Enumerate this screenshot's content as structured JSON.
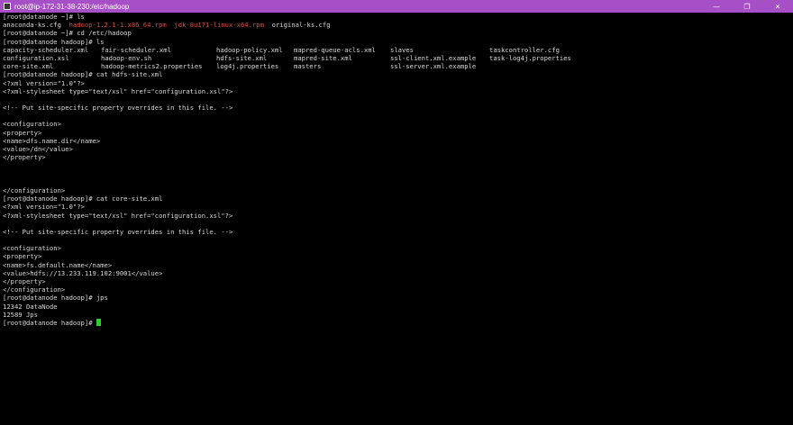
{
  "window": {
    "title": "root@ip-172-31-38-230:/etc/hadoop",
    "minimize_icon": "minimize-icon",
    "maximize_icon": "maximize-icon",
    "close_icon": "close-icon",
    "titlebar_color": "#a64fc6"
  },
  "terminal": {
    "line_00": "[root@datanode ~]# ls",
    "ls_files": [
      "anaconda-ks.cfg",
      "hadoop-1.2.1-1.x86_64.rpm",
      "jdk-8u171-linux-x64.rpm",
      "original-ks.cfg"
    ],
    "line_02": "[root@datanode ~]# cd /etc/hadoop",
    "line_03": "[root@datanode hadoop]# ls",
    "dir_row_1": [
      "capacity-scheduler.xml",
      "fair-scheduler.xml",
      "hadoop-policy.xml",
      "mapred-queue-acls.xml",
      "slaves",
      "taskcontroller.cfg"
    ],
    "dir_row_2": [
      "configuration.xsl",
      "hadoop-env.sh",
      "hdfs-site.xml",
      "mapred-site.xml",
      "ssl-client.xml.example",
      "task-log4j.properties"
    ],
    "dir_row_3": [
      "core-site.xml",
      "hadoop-metrics2.properties",
      "log4j.properties",
      "masters",
      "ssl-server.xml.example"
    ],
    "line_07": "[root@datanode hadoop]# cat hdfs-site.xml",
    "line_08": "<?xml version=\"1.0\"?>",
    "line_09": "<?xml-stylesheet type=\"text/xsl\" href=\"configuration.xsl\"?>",
    "line_10": "",
    "line_11": "<!-- Put site-specific property overrides in this file. -->",
    "line_12": "",
    "line_13": "<configuration>",
    "line_14": "<property>",
    "line_15": "<name>dfs.name.dir</name>",
    "line_16": "<value>/dn</value>",
    "line_17": "</property>",
    "line_18": "",
    "line_19": "",
    "line_20": "",
    "line_21": "</configuration>",
    "line_22": "[root@datanode hadoop]# cat core-site.xml",
    "line_23": "<?xml version=\"1.0\"?>",
    "line_24": "<?xml-stylesheet type=\"text/xsl\" href=\"configuration.xsl\"?>",
    "line_25": "",
    "line_26": "<!-- Put site-specific property overrides in this file. -->",
    "line_27": "",
    "line_28": "<configuration>",
    "line_29": "<property>",
    "line_30": "<name>fs.default.name</name>",
    "line_31": "<value>hdfs://13.233.119.102:9001</value>",
    "line_32": "</property>",
    "line_33": "</configuration>",
    "line_34": "[root@datanode hadoop]# jps",
    "line_35": "12342 DataNode",
    "line_36": "12589 Jps",
    "prompt": "[root@datanode hadoop]#",
    "rpm_color": "#e14b3c",
    "cursor_color": "#1ddb1d"
  }
}
